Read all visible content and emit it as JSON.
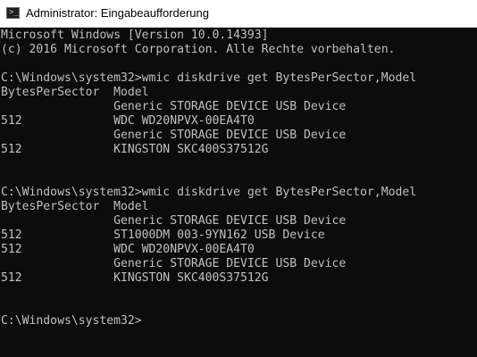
{
  "window": {
    "title": "Administrator: Eingabeaufforderung",
    "icon": "cmd-icon"
  },
  "console": {
    "lines": [
      "Microsoft Windows [Version 10.0.14393]",
      "(c) 2016 Microsoft Corporation. Alle Rechte vorbehalten.",
      "",
      "C:\\Windows\\system32>wmic diskdrive get BytesPerSector,Model",
      "BytesPerSector  Model",
      "                Generic STORAGE DEVICE USB Device",
      "512             WDC WD20NPVX-00EA4T0",
      "                Generic STORAGE DEVICE USB Device",
      "512             KINGSTON SKC400S37512G",
      "",
      "",
      "C:\\Windows\\system32>wmic diskdrive get BytesPerSector,Model",
      "BytesPerSector  Model",
      "                Generic STORAGE DEVICE USB Device",
      "512             ST1000DM 003-9YN162 USB Device",
      "512             WDC WD20NPVX-00EA4T0",
      "                Generic STORAGE DEVICE USB Device",
      "512             KINGSTON SKC400S37512G",
      "",
      "",
      "C:\\Windows\\system32>"
    ]
  }
}
